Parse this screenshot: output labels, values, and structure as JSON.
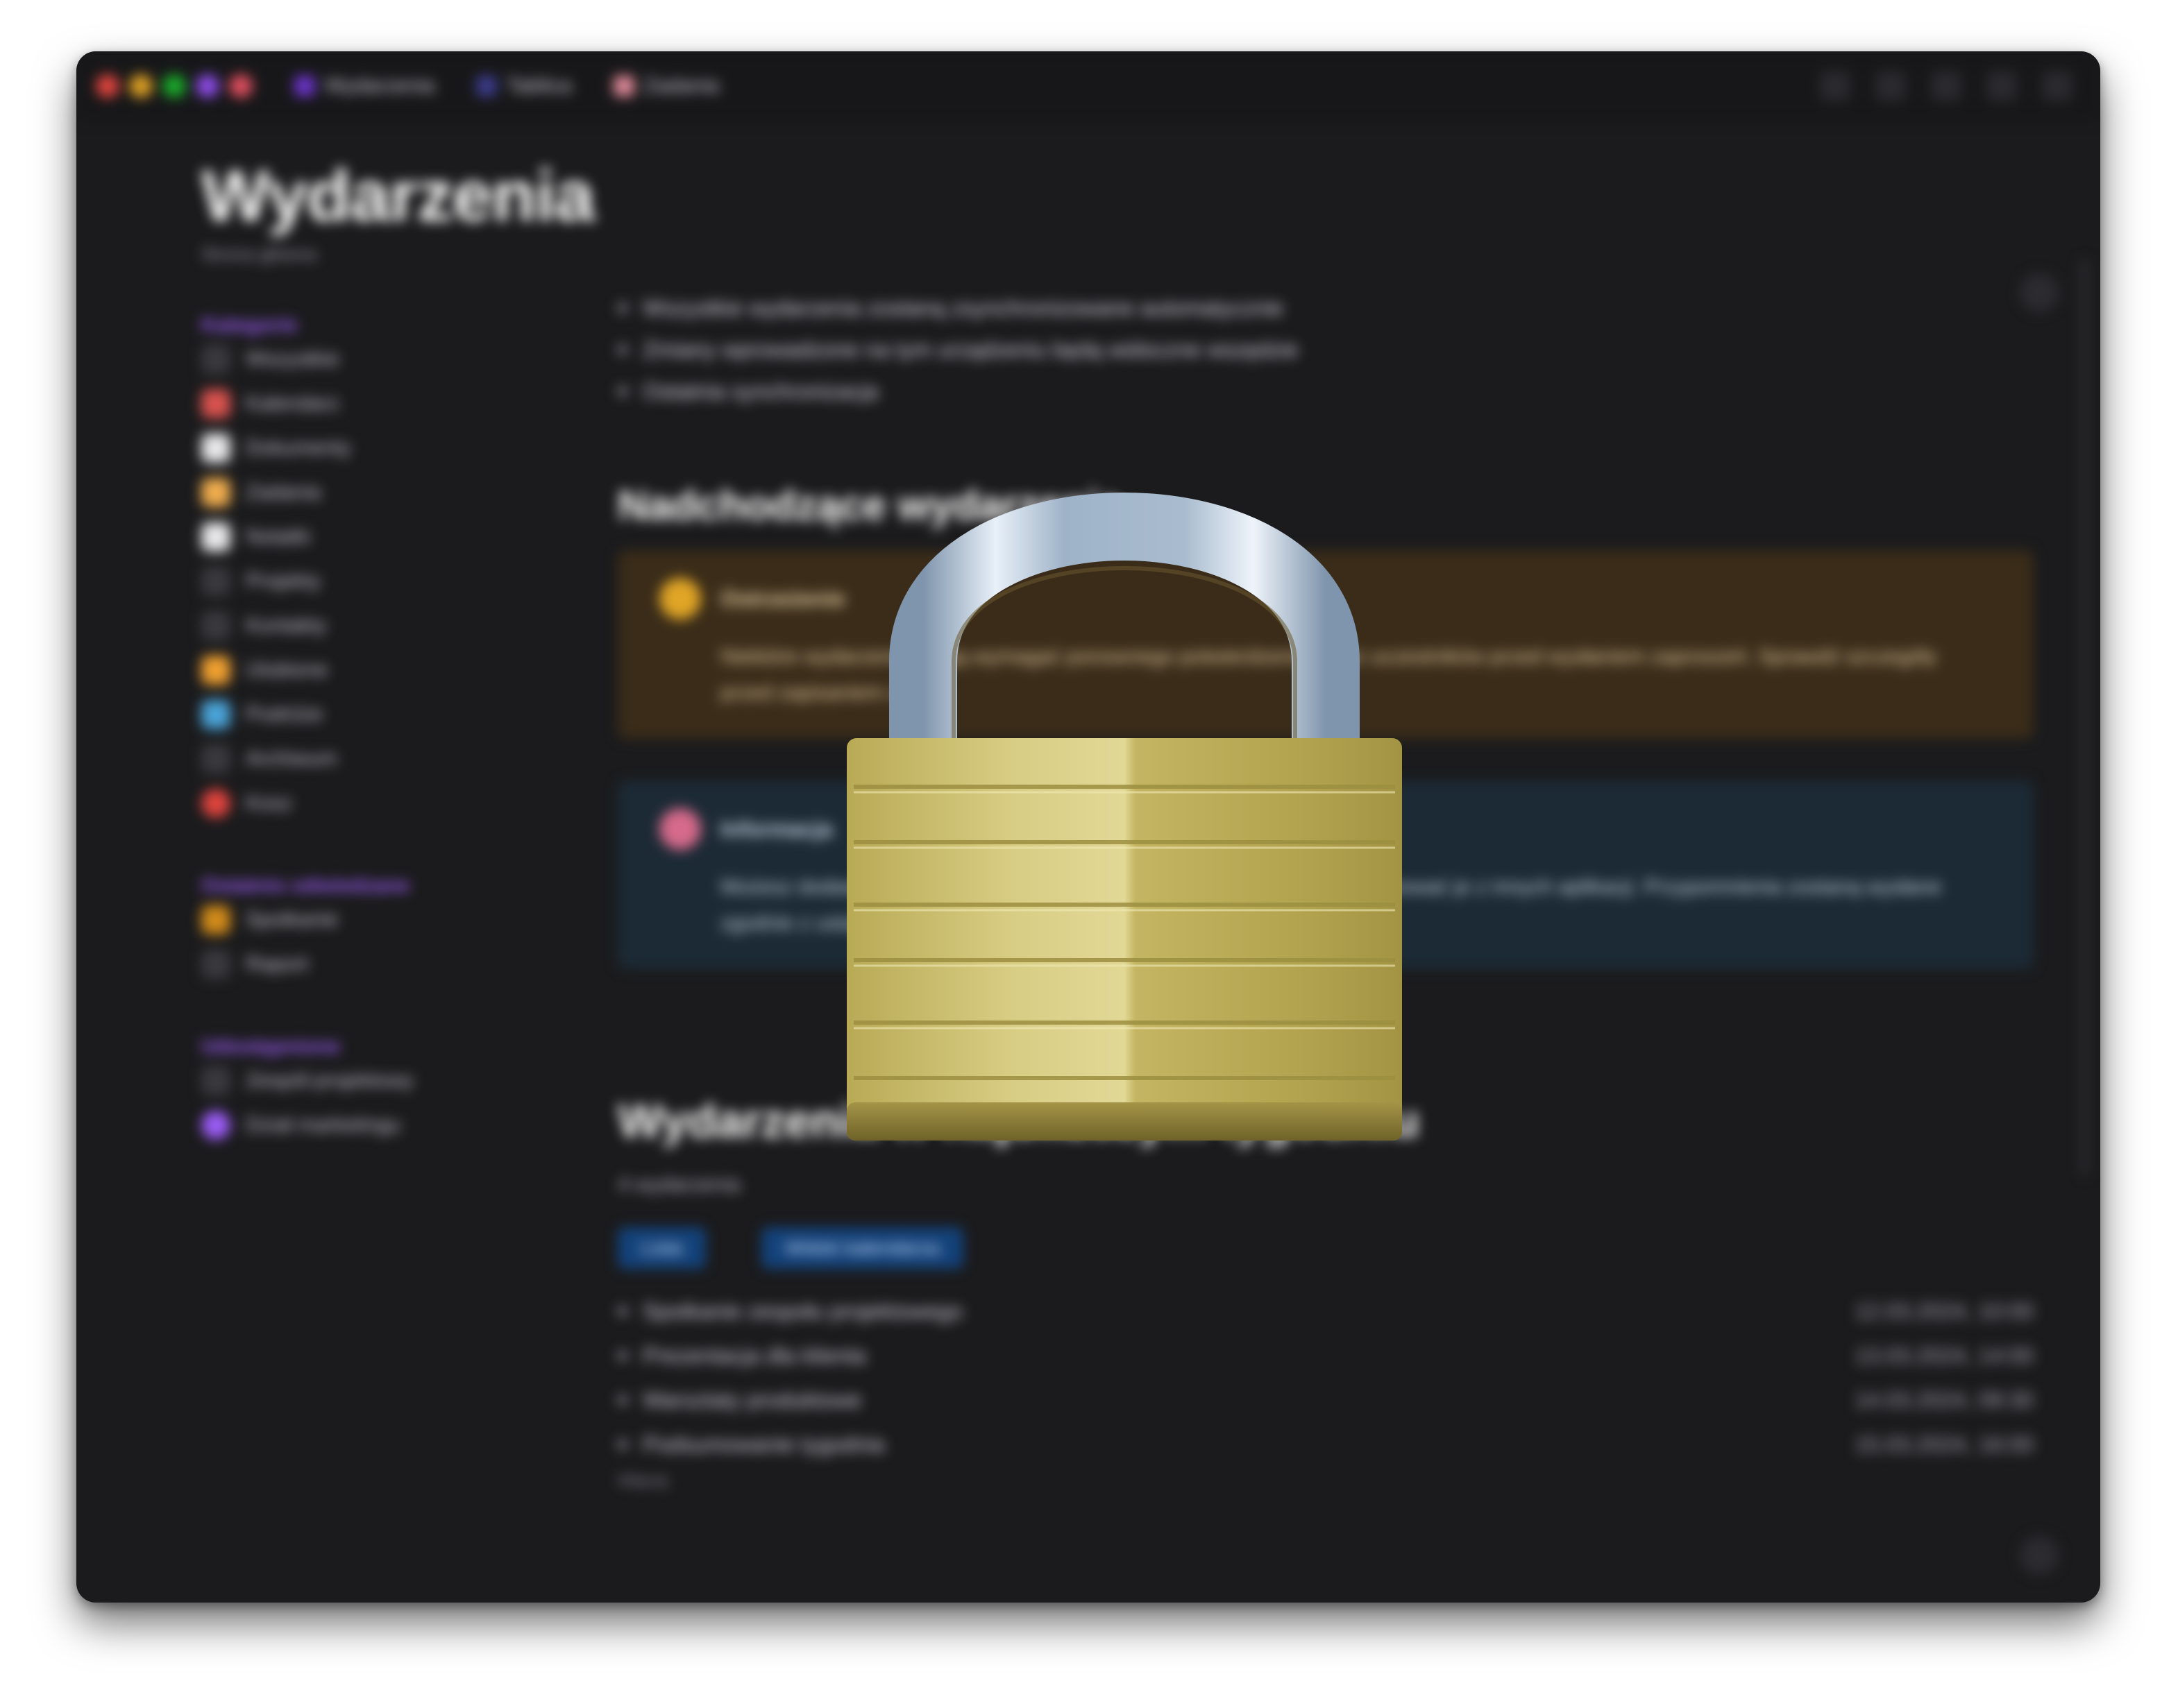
{
  "window": {
    "traffic_colors": [
      "#e0443e",
      "#dea123",
      "#1aab29",
      "#8c4be6",
      "#e04f5f"
    ],
    "tabs": [
      {
        "label": "Wydarzenia",
        "icon": "calendar-icon",
        "color": "#6b34c9"
      },
      {
        "label": "Tablica",
        "icon": "board-icon",
        "color": "#3b3b8c"
      },
      {
        "label": "Zadania",
        "icon": "tasks-icon",
        "color": "#e08a9a"
      }
    ],
    "toolbar_icons": [
      "search-icon",
      "share-icon",
      "bell-icon",
      "settings-icon",
      "user-icon"
    ]
  },
  "sidebar": {
    "brand": "Wydarzenia",
    "brand_sub": "Strona główna",
    "sections": [
      {
        "heading": "Kategorie",
        "items": [
          {
            "label": "Wszystkie",
            "color": "#3a3a3e"
          },
          {
            "label": "Kalendarz",
            "color": "#d9534f"
          },
          {
            "label": "Dokumenty",
            "color": "#e8e8ea"
          },
          {
            "label": "Zadania",
            "color": "#f0ad4e"
          },
          {
            "label": "Notatki",
            "color": "#e8e8ea"
          },
          {
            "label": "Projekty",
            "color": "#3a3a3e"
          },
          {
            "label": "Kontakty",
            "color": "#3a3a3e"
          },
          {
            "label": "Ulubione",
            "color": "#f0a030"
          },
          {
            "label": "Podróże",
            "color": "#4aa3d8"
          },
          {
            "label": "Archiwum",
            "color": "#3a3a3e"
          },
          {
            "label": "Kosz",
            "color": "#e0443e"
          }
        ]
      },
      {
        "heading": "Ostatnio odwiedzane",
        "items": [
          {
            "label": "Spotkanie",
            "color": "#d08a1a"
          },
          {
            "label": "Raport",
            "color": "#3a3a3e"
          }
        ]
      },
      {
        "heading": "Udostępnione",
        "items": [
          {
            "label": "Zespół projektowy",
            "color": "#3a3a3e"
          },
          {
            "label": "Dział marketingu",
            "color": "#9b5cf6"
          }
        ]
      }
    ]
  },
  "main": {
    "info_lines": [
      "Wszystkie wydarzenia zostaną zsynchronizowane automatycznie",
      "Zmiany wprowadzone na tym urządzeniu będą widoczne wszędzie",
      "Ostatnia synchronizacja"
    ],
    "section1_title": "Nadchodzące wydarzenia",
    "warning": {
      "title": "Ostrzeżenie",
      "icon": "warning-icon",
      "text": "Niektóre wydarzenia mogą wymagać ponownego potwierdzenia przez uczestników przed wysłaniem zaproszeń. Sprawdź szczegóły przed zapisaniem zmian."
    },
    "note": {
      "title": "Informacja",
      "icon": "info-icon",
      "text": "Możesz dodawać nowe wydarzenia bezpośrednio z kalendarza lub importować je z innych aplikacji. Przypomnienia zostaną wysłane zgodnie z ustawieniami powiadomień."
    },
    "section2_title": "Wydarzenia w najbliższym tygodniu",
    "section2_sub": "4 wydarzenia",
    "pills": [
      "Lista",
      "Widok kalendarza"
    ],
    "events": [
      {
        "name": "Spotkanie zespołu projektowego",
        "date": "12.03.2024, 10:00"
      },
      {
        "name": "Prezentacja dla klienta",
        "date": "13.03.2024, 14:00"
      },
      {
        "name": "Warsztaty produktowe",
        "date": "14.03.2024, 09:30"
      },
      {
        "name": "Podsumowanie tygodnia",
        "date": "15.03.2024, 16:00"
      }
    ],
    "more_label": "Więcej"
  },
  "overlay": {
    "icon": "padlock-icon",
    "shackle_color": "#c9d6e3",
    "body_color": "#c9bc68"
  }
}
